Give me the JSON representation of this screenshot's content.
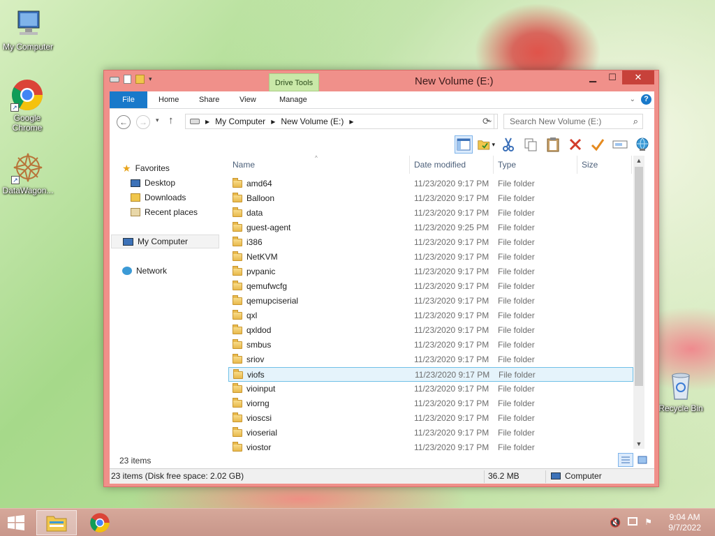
{
  "desktop": {
    "icons": [
      {
        "label": "My Computer"
      },
      {
        "label": "Google Chrome"
      },
      {
        "label": "DataWagon..."
      },
      {
        "label": "Recycle Bin"
      }
    ]
  },
  "window": {
    "title": "New Volume (E:)",
    "context_tab": "Drive Tools",
    "tabs": [
      "File",
      "Home",
      "Share",
      "View",
      "Manage"
    ],
    "address": {
      "crumbs": [
        "My Computer",
        "New Volume (E:)"
      ]
    },
    "search_placeholder": "Search New Volume (E:)",
    "nav": {
      "favorites": "Favorites",
      "desktop": "Desktop",
      "downloads": "Downloads",
      "recent": "Recent places",
      "computer": "My Computer",
      "network": "Network"
    },
    "columns": [
      "Name",
      "Date modified",
      "Type",
      "Size"
    ],
    "files": [
      {
        "name": "amd64",
        "date": "11/23/2020 9:17 PM",
        "type": "File folder"
      },
      {
        "name": "Balloon",
        "date": "11/23/2020 9:17 PM",
        "type": "File folder"
      },
      {
        "name": "data",
        "date": "11/23/2020 9:17 PM",
        "type": "File folder"
      },
      {
        "name": "guest-agent",
        "date": "11/23/2020 9:25 PM",
        "type": "File folder"
      },
      {
        "name": "i386",
        "date": "11/23/2020 9:17 PM",
        "type": "File folder"
      },
      {
        "name": "NetKVM",
        "date": "11/23/2020 9:17 PM",
        "type": "File folder"
      },
      {
        "name": "pvpanic",
        "date": "11/23/2020 9:17 PM",
        "type": "File folder"
      },
      {
        "name": "qemufwcfg",
        "date": "11/23/2020 9:17 PM",
        "type": "File folder"
      },
      {
        "name": "qemupciserial",
        "date": "11/23/2020 9:17 PM",
        "type": "File folder"
      },
      {
        "name": "qxl",
        "date": "11/23/2020 9:17 PM",
        "type": "File folder"
      },
      {
        "name": "qxldod",
        "date": "11/23/2020 9:17 PM",
        "type": "File folder"
      },
      {
        "name": "smbus",
        "date": "11/23/2020 9:17 PM",
        "type": "File folder"
      },
      {
        "name": "sriov",
        "date": "11/23/2020 9:17 PM",
        "type": "File folder"
      },
      {
        "name": "viofs",
        "date": "11/23/2020 9:17 PM",
        "type": "File folder",
        "selected": true
      },
      {
        "name": "vioinput",
        "date": "11/23/2020 9:17 PM",
        "type": "File folder"
      },
      {
        "name": "viorng",
        "date": "11/23/2020 9:17 PM",
        "type": "File folder"
      },
      {
        "name": "vioscsi",
        "date": "11/23/2020 9:17 PM",
        "type": "File folder"
      },
      {
        "name": "vioserial",
        "date": "11/23/2020 9:17 PM",
        "type": "File folder"
      },
      {
        "name": "viostor",
        "date": "11/23/2020 9:17 PM",
        "type": "File folder"
      }
    ],
    "item_count": "23 items",
    "status": {
      "left": "23 items (Disk free space: 2.02 GB)",
      "size": "36.2 MB",
      "location": "Computer"
    }
  },
  "taskbar": {
    "time": "9:04 AM",
    "date": "9/7/2022"
  },
  "colors": {
    "accent": "#1979ca",
    "titlebar": "#f0908a",
    "selection": "#e5f3fb"
  }
}
